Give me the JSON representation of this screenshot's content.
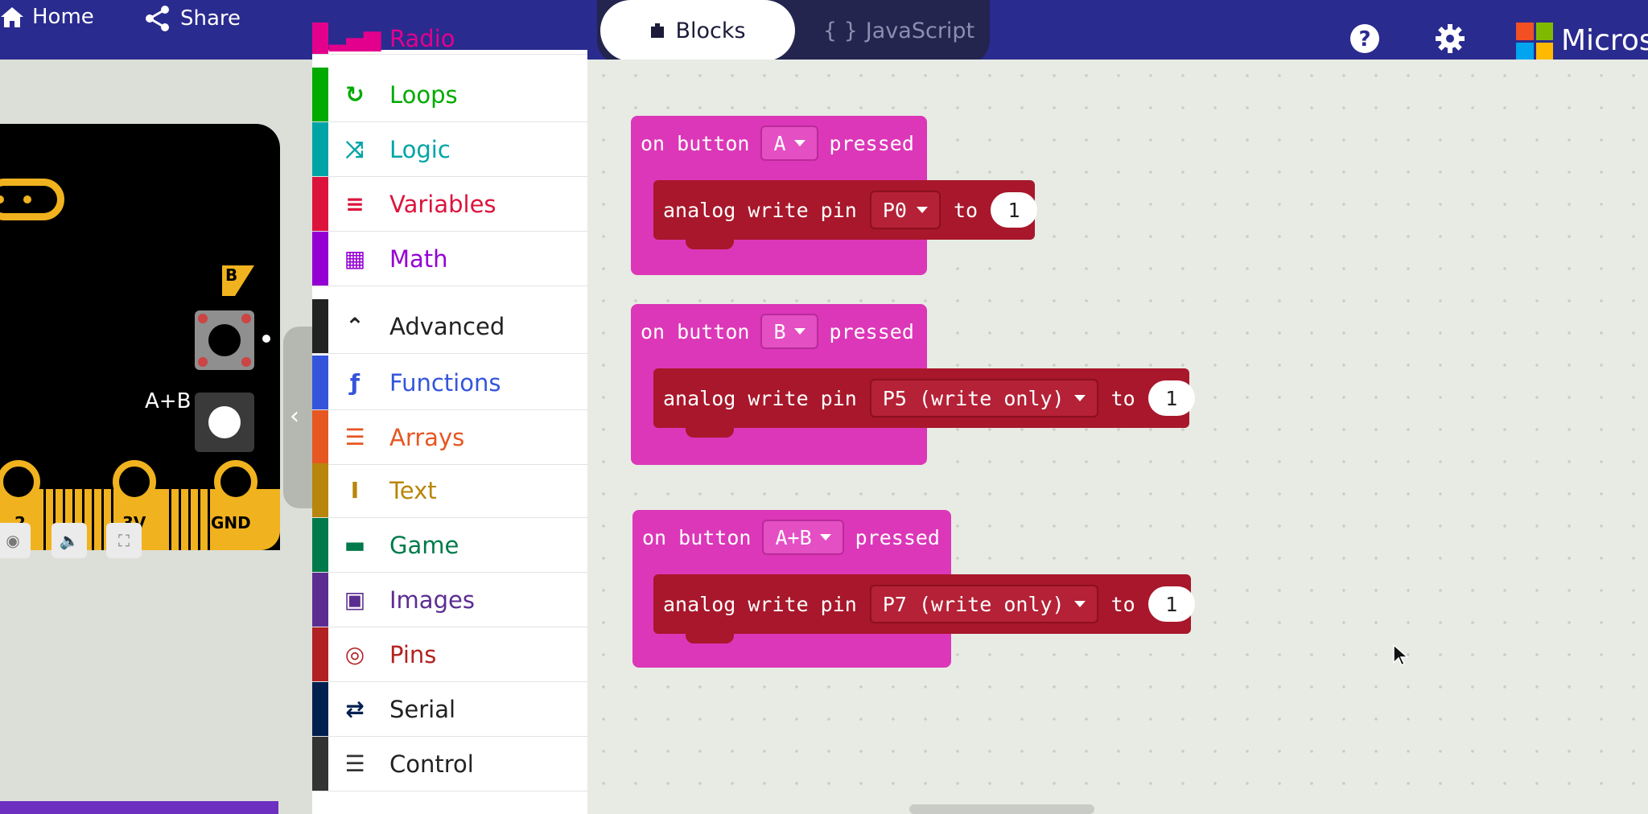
{
  "header": {
    "home": "Home",
    "share": "Share",
    "blocks": "Blocks",
    "javascript": "JavaScript",
    "brand": "Micros",
    "colors": {
      "bar": "#2a2b8f"
    }
  },
  "simulator": {
    "button_b": "B",
    "button_ab": "A+B",
    "pin_2": "2",
    "pin_3v": "3V",
    "pin_gnd": "GND"
  },
  "toolbox": {
    "items": [
      {
        "label": "Radio",
        "icon": "signal-icon",
        "color": "#e3008c"
      },
      {
        "label": "Loops",
        "icon": "loop-icon",
        "color": "#00aa00"
      },
      {
        "label": "Logic",
        "icon": "shuffle-icon",
        "color": "#00a4a6"
      },
      {
        "label": "Variables",
        "icon": "list-icon",
        "color": "#dc143c"
      },
      {
        "label": "Math",
        "icon": "calculator-icon",
        "color": "#9400d3"
      },
      {
        "label": "Advanced",
        "icon": "chevron-up-icon",
        "color": "#222222"
      },
      {
        "label": "Functions",
        "icon": "function-icon",
        "color": "#3455db"
      },
      {
        "label": "Arrays",
        "icon": "ordered-list-icon",
        "color": "#e65722"
      },
      {
        "label": "Text",
        "icon": "text-cursor-icon",
        "color": "#b8860b"
      },
      {
        "label": "Game",
        "icon": "gamepad-icon",
        "color": "#007a4b"
      },
      {
        "label": "Images",
        "icon": "image-icon",
        "color": "#5c2d91"
      },
      {
        "label": "Pins",
        "icon": "target-icon",
        "color": "#b22222"
      },
      {
        "label": "Serial",
        "icon": "usb-icon",
        "color": "#002050"
      },
      {
        "label": "Control",
        "icon": "server-icon",
        "color": "#333333"
      }
    ]
  },
  "workspace": {
    "blocks": [
      {
        "event": "on button",
        "button": "A",
        "pressed": "pressed",
        "action": "analog write pin",
        "pin": "P0",
        "to": "to",
        "value": "1"
      },
      {
        "event": "on button",
        "button": "B",
        "pressed": "pressed",
        "action": "analog write pin",
        "pin": "P5 (write only)",
        "to": "to",
        "value": "1"
      },
      {
        "event": "on button",
        "button": "A+B",
        "pressed": "pressed",
        "action": "analog write pin",
        "pin": "P7 (write only)",
        "to": "to",
        "value": "1"
      }
    ]
  }
}
